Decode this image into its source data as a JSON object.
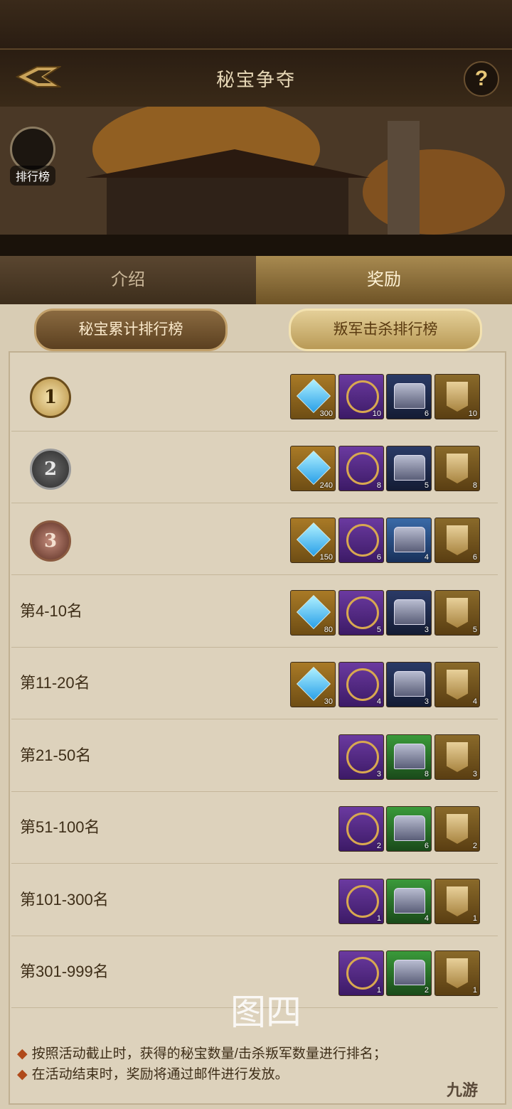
{
  "header": {
    "title": "秘宝争夺",
    "help": "?"
  },
  "banner": {
    "rank_label": "排行榜"
  },
  "tabs": [
    {
      "label": "介绍"
    },
    {
      "label": "奖励"
    }
  ],
  "subtabs": [
    {
      "label": "秘宝累计排行榜"
    },
    {
      "label": "叛军击杀排行榜"
    }
  ],
  "rows": [
    {
      "rank": "1",
      "label": "",
      "items": [
        {
          "type": "gem",
          "count": "300"
        },
        {
          "type": "ham",
          "count": "10"
        },
        {
          "type": "chestp",
          "count": "6"
        },
        {
          "type": "ban",
          "count": "10"
        }
      ]
    },
    {
      "rank": "2",
      "label": "",
      "items": [
        {
          "type": "gem",
          "count": "240"
        },
        {
          "type": "ham",
          "count": "8"
        },
        {
          "type": "chestp",
          "count": "5"
        },
        {
          "type": "ban",
          "count": "8"
        }
      ]
    },
    {
      "rank": "3",
      "label": "",
      "items": [
        {
          "type": "gem",
          "count": "150"
        },
        {
          "type": "ham",
          "count": "6"
        },
        {
          "type": "chestb",
          "count": "4"
        },
        {
          "type": "ban",
          "count": "6"
        }
      ]
    },
    {
      "rank": "",
      "label": "第4-10名",
      "items": [
        {
          "type": "gem",
          "count": "80"
        },
        {
          "type": "ham",
          "count": "5"
        },
        {
          "type": "chestp",
          "count": "3"
        },
        {
          "type": "ban",
          "count": "5"
        }
      ]
    },
    {
      "rank": "",
      "label": "第11-20名",
      "items": [
        {
          "type": "gem",
          "count": "30"
        },
        {
          "type": "ham",
          "count": "4"
        },
        {
          "type": "chestp",
          "count": "3"
        },
        {
          "type": "ban",
          "count": "4"
        }
      ]
    },
    {
      "rank": "",
      "label": "第21-50名",
      "items": [
        {
          "type": "ham",
          "count": "3"
        },
        {
          "type": "chestg",
          "count": "8"
        },
        {
          "type": "ban",
          "count": "3"
        }
      ]
    },
    {
      "rank": "",
      "label": "第51-100名",
      "items": [
        {
          "type": "ham",
          "count": "2"
        },
        {
          "type": "chestg",
          "count": "6"
        },
        {
          "type": "ban",
          "count": "2"
        }
      ]
    },
    {
      "rank": "",
      "label": "第101-300名",
      "items": [
        {
          "type": "ham",
          "count": "1"
        },
        {
          "type": "chestg",
          "count": "4"
        },
        {
          "type": "ban",
          "count": "1"
        }
      ]
    },
    {
      "rank": "",
      "label": "第301-999名",
      "items": [
        {
          "type": "ham",
          "count": "1"
        },
        {
          "type": "chestg",
          "count": "2"
        },
        {
          "type": "ban",
          "count": "1"
        }
      ]
    }
  ],
  "notes": [
    "按照活动截止时，获得的秘宝数量/击杀叛军数量进行排名；",
    "在活动结束时，奖励将通过邮件进行发放。"
  ],
  "watermark": "图四",
  "logo": "九游"
}
